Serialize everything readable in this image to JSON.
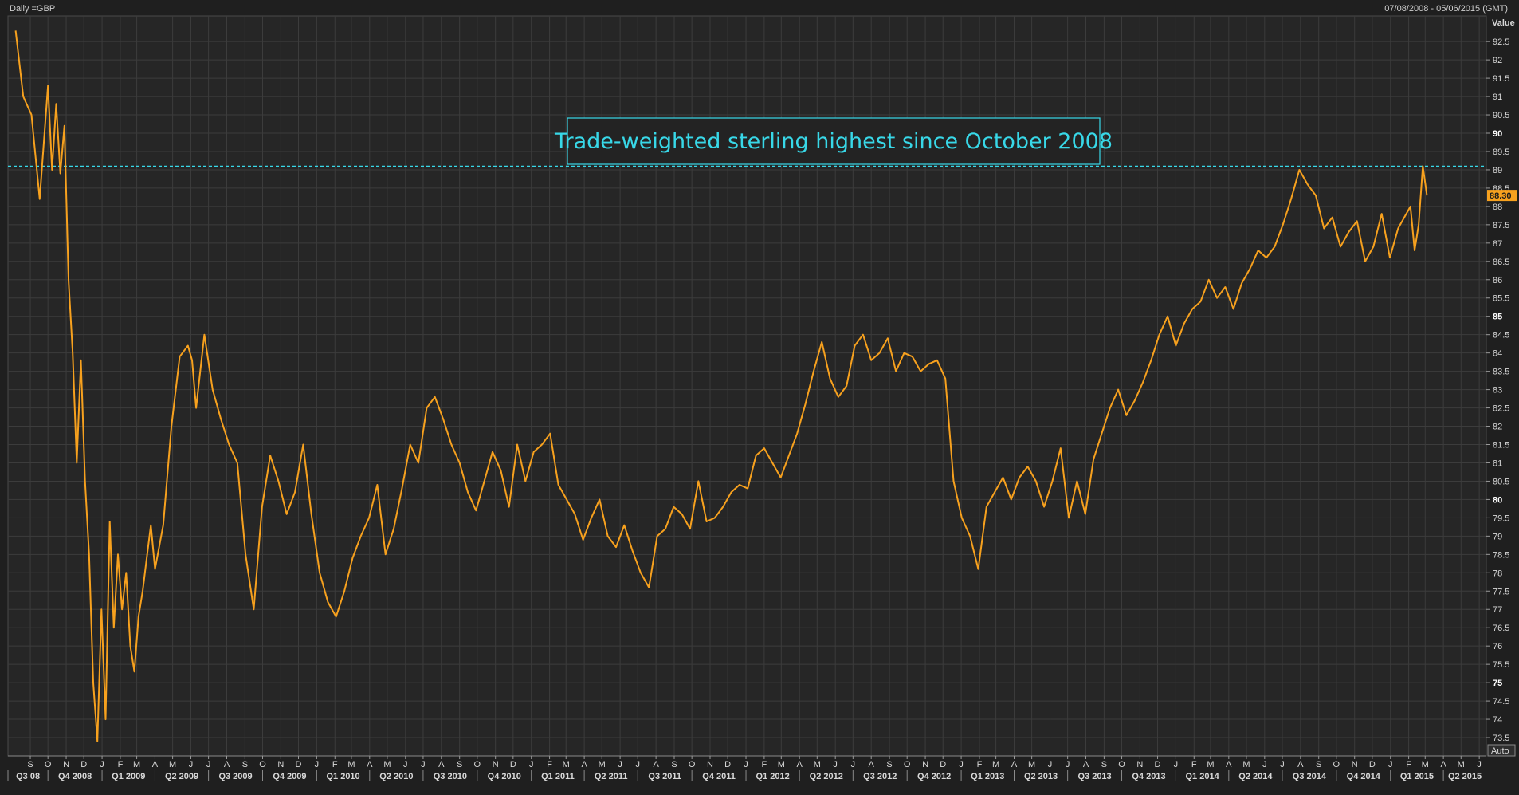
{
  "header": {
    "left_text": "Daily =GBP",
    "right_text": "07/08/2008 - 05/06/2015 (GMT)"
  },
  "colors": {
    "background": "#1f1f1f",
    "plot_background": "#262626",
    "grid": "#3c3c3c",
    "line": "#f7a11e",
    "annotation": "#38d8e8",
    "price_tag": "#f7a11e"
  },
  "chart_data": {
    "type": "line",
    "title": "",
    "xlabel": "",
    "ylabel": "Value",
    "ylim": [
      73,
      93
    ],
    "grid": true,
    "legend": "none",
    "series": [
      {
        "name": "",
        "x": [
          "2008-08-07",
          "2008-08-20",
          "2008-09-03",
          "2008-09-17",
          "2008-10-01",
          "2008-10-08",
          "2008-10-15",
          "2008-10-22",
          "2008-10-29",
          "2008-11-05",
          "2008-11-12",
          "2008-11-19",
          "2008-11-26",
          "2008-12-03",
          "2008-12-10",
          "2008-12-17",
          "2008-12-24",
          "2008-12-31",
          "2009-01-07",
          "2009-01-14",
          "2009-01-21",
          "2009-01-28",
          "2009-02-04",
          "2009-02-11",
          "2009-02-18",
          "2009-02-25",
          "2009-03-04",
          "2009-03-11",
          "2009-03-18",
          "2009-03-25",
          "2009-04-01",
          "2009-04-15",
          "2009-04-29",
          "2009-05-13",
          "2009-05-27",
          "2009-06-03",
          "2009-06-10",
          "2009-06-24",
          "2009-07-08",
          "2009-07-22",
          "2009-08-05",
          "2009-08-19",
          "2009-09-02",
          "2009-09-16",
          "2009-09-30",
          "2009-10-14",
          "2009-10-28",
          "2009-11-11",
          "2009-11-25",
          "2009-12-09",
          "2009-12-23",
          "2010-01-06",
          "2010-01-20",
          "2010-02-03",
          "2010-02-17",
          "2010-03-03",
          "2010-03-17",
          "2010-03-31",
          "2010-04-14",
          "2010-04-28",
          "2010-05-12",
          "2010-05-26",
          "2010-06-09",
          "2010-06-23",
          "2010-07-07",
          "2010-07-21",
          "2010-08-04",
          "2010-08-18",
          "2010-09-01",
          "2010-09-15",
          "2010-09-29",
          "2010-10-13",
          "2010-10-27",
          "2010-11-10",
          "2010-11-24",
          "2010-12-08",
          "2010-12-22",
          "2011-01-05",
          "2011-01-19",
          "2011-02-02",
          "2011-02-16",
          "2011-03-02",
          "2011-03-16",
          "2011-03-30",
          "2011-04-13",
          "2011-04-27",
          "2011-05-11",
          "2011-05-25",
          "2011-06-08",
          "2011-06-22",
          "2011-07-06",
          "2011-07-20",
          "2011-08-03",
          "2011-08-17",
          "2011-08-31",
          "2011-09-14",
          "2011-09-28",
          "2011-10-12",
          "2011-10-26",
          "2011-11-09",
          "2011-11-23",
          "2011-12-07",
          "2011-12-21",
          "2012-01-04",
          "2012-01-18",
          "2012-02-01",
          "2012-02-15",
          "2012-02-29",
          "2012-03-14",
          "2012-03-28",
          "2012-04-11",
          "2012-04-25",
          "2012-05-09",
          "2012-05-23",
          "2012-06-06",
          "2012-06-20",
          "2012-07-04",
          "2012-07-18",
          "2012-08-01",
          "2012-08-15",
          "2012-08-29",
          "2012-09-12",
          "2012-09-26",
          "2012-10-10",
          "2012-10-24",
          "2012-11-07",
          "2012-11-21",
          "2012-12-05",
          "2012-12-19",
          "2013-01-02",
          "2013-01-16",
          "2013-01-30",
          "2013-02-13",
          "2013-02-27",
          "2013-03-13",
          "2013-03-27",
          "2013-04-10",
          "2013-04-24",
          "2013-05-08",
          "2013-05-22",
          "2013-06-05",
          "2013-06-19",
          "2013-07-03",
          "2013-07-17",
          "2013-07-31",
          "2013-08-14",
          "2013-08-28",
          "2013-09-11",
          "2013-09-25",
          "2013-10-09",
          "2013-10-23",
          "2013-11-06",
          "2013-11-20",
          "2013-12-04",
          "2013-12-18",
          "2014-01-01",
          "2014-01-15",
          "2014-01-29",
          "2014-02-12",
          "2014-02-26",
          "2014-03-12",
          "2014-03-26",
          "2014-04-09",
          "2014-04-23",
          "2014-05-07",
          "2014-05-21",
          "2014-06-04",
          "2014-06-18",
          "2014-07-02",
          "2014-07-16",
          "2014-07-30",
          "2014-08-13",
          "2014-08-27",
          "2014-09-10",
          "2014-09-24",
          "2014-10-08",
          "2014-10-22",
          "2014-11-05",
          "2014-11-19",
          "2014-12-03",
          "2014-12-17",
          "2014-12-31",
          "2015-01-14",
          "2015-01-28",
          "2015-02-04",
          "2015-02-11",
          "2015-02-18",
          "2015-02-25",
          "2015-03-04"
        ],
        "values": [
          92.8,
          91.0,
          90.5,
          88.2,
          91.3,
          89.0,
          90.8,
          88.9,
          90.2,
          86.0,
          84.0,
          81.0,
          83.8,
          80.5,
          78.5,
          75.0,
          73.4,
          77.0,
          74.0,
          79.4,
          76.5,
          78.5,
          77.0,
          78.0,
          76.0,
          75.3,
          76.8,
          77.5,
          78.4,
          79.3,
          78.1,
          79.3,
          82.0,
          83.9,
          84.2,
          83.8,
          82.5,
          84.5,
          83.0,
          82.2,
          81.5,
          81.0,
          78.5,
          77.0,
          79.8,
          81.2,
          80.5,
          79.6,
          80.2,
          81.5,
          79.6,
          78.0,
          77.2,
          76.8,
          77.5,
          78.4,
          79.0,
          79.5,
          80.4,
          78.5,
          79.2,
          80.3,
          81.5,
          81.0,
          82.5,
          82.8,
          82.2,
          81.5,
          81.0,
          80.2,
          79.7,
          80.5,
          81.3,
          80.8,
          79.8,
          81.5,
          80.5,
          81.3,
          81.5,
          81.8,
          80.4,
          80.0,
          79.6,
          78.9,
          79.5,
          80.0,
          79.0,
          78.7,
          79.3,
          78.6,
          78.0,
          77.6,
          79.0,
          79.2,
          79.8,
          79.6,
          79.2,
          80.5,
          79.4,
          79.5,
          79.8,
          80.2,
          80.4,
          80.3,
          81.2,
          81.4,
          81.0,
          80.6,
          81.2,
          81.8,
          82.6,
          83.5,
          84.3,
          83.3,
          82.8,
          83.1,
          84.2,
          84.5,
          83.8,
          84.0,
          84.4,
          83.5,
          84.0,
          83.9,
          83.5,
          83.7,
          83.8,
          83.3,
          80.5,
          79.5,
          79.0,
          78.1,
          79.8,
          80.2,
          80.6,
          80.0,
          80.6,
          80.9,
          80.5,
          79.8,
          80.5,
          81.4,
          79.5,
          80.5,
          79.6,
          81.1,
          81.8,
          82.5,
          83.0,
          82.3,
          82.7,
          83.2,
          83.8,
          84.5,
          85.0,
          84.2,
          84.8,
          85.2,
          85.4,
          86.0,
          85.5,
          85.8,
          85.2,
          85.9,
          86.3,
          86.8,
          86.6,
          86.9,
          87.5,
          88.2,
          89.0,
          88.6,
          88.3,
          87.4,
          87.7,
          86.9,
          87.3,
          87.6,
          86.5,
          86.9,
          87.8,
          86.6,
          87.4,
          87.8,
          88.0,
          86.8,
          87.5,
          89.1,
          88.3
        ]
      }
    ],
    "y_ticks": [
      "73.5",
      "74",
      "74.5",
      "75",
      "75.5",
      "76",
      "76.5",
      "77",
      "77.5",
      "78",
      "78.5",
      "79",
      "79.5",
      "80",
      "80.5",
      "81",
      "81.5",
      "82",
      "82.5",
      "83",
      "83.5",
      "84",
      "84.5",
      "85",
      "85.5",
      "86",
      "86.5",
      "87",
      "87.5",
      "88",
      "88.5",
      "89",
      "89.5",
      "90",
      "90.5",
      "91",
      "91.5",
      "92",
      "92.5"
    ],
    "y_ticks_bold": [
      "75",
      "80",
      "85",
      "90"
    ],
    "last_value": 88.3,
    "last_value_label": "88.30",
    "y_axis_header": "Value",
    "auto_label": "Auto",
    "x_month_ticks": [
      {
        "date": "2008-09-01",
        "label": "S"
      },
      {
        "date": "2008-10-01",
        "label": "O"
      },
      {
        "date": "2008-11-01",
        "label": "N"
      },
      {
        "date": "2008-12-01",
        "label": "D"
      },
      {
        "date": "2009-01-01",
        "label": "J"
      },
      {
        "date": "2009-02-01",
        "label": "F"
      },
      {
        "date": "2009-03-01",
        "label": "M"
      },
      {
        "date": "2009-04-01",
        "label": "A"
      },
      {
        "date": "2009-05-01",
        "label": "M"
      },
      {
        "date": "2009-06-01",
        "label": "J"
      },
      {
        "date": "2009-07-01",
        "label": "J"
      },
      {
        "date": "2009-08-01",
        "label": "A"
      },
      {
        "date": "2009-09-01",
        "label": "S"
      },
      {
        "date": "2009-10-01",
        "label": "O"
      },
      {
        "date": "2009-11-01",
        "label": "N"
      },
      {
        "date": "2009-12-01",
        "label": "D"
      },
      {
        "date": "2010-01-01",
        "label": "J"
      },
      {
        "date": "2010-02-01",
        "label": "F"
      },
      {
        "date": "2010-03-01",
        "label": "M"
      },
      {
        "date": "2010-04-01",
        "label": "A"
      },
      {
        "date": "2010-05-01",
        "label": "M"
      },
      {
        "date": "2010-06-01",
        "label": "J"
      },
      {
        "date": "2010-07-01",
        "label": "J"
      },
      {
        "date": "2010-08-01",
        "label": "A"
      },
      {
        "date": "2010-09-01",
        "label": "S"
      },
      {
        "date": "2010-10-01",
        "label": "O"
      },
      {
        "date": "2010-11-01",
        "label": "N"
      },
      {
        "date": "2010-12-01",
        "label": "D"
      },
      {
        "date": "2011-01-01",
        "label": "J"
      },
      {
        "date": "2011-02-01",
        "label": "F"
      },
      {
        "date": "2011-03-01",
        "label": "M"
      },
      {
        "date": "2011-04-01",
        "label": "A"
      },
      {
        "date": "2011-05-01",
        "label": "M"
      },
      {
        "date": "2011-06-01",
        "label": "J"
      },
      {
        "date": "2011-07-01",
        "label": "J"
      },
      {
        "date": "2011-08-01",
        "label": "A"
      },
      {
        "date": "2011-09-01",
        "label": "S"
      },
      {
        "date": "2011-10-01",
        "label": "O"
      },
      {
        "date": "2011-11-01",
        "label": "N"
      },
      {
        "date": "2011-12-01",
        "label": "D"
      },
      {
        "date": "2012-01-01",
        "label": "J"
      },
      {
        "date": "2012-02-01",
        "label": "F"
      },
      {
        "date": "2012-03-01",
        "label": "M"
      },
      {
        "date": "2012-04-01",
        "label": "A"
      },
      {
        "date": "2012-05-01",
        "label": "M"
      },
      {
        "date": "2012-06-01",
        "label": "J"
      },
      {
        "date": "2012-07-01",
        "label": "J"
      },
      {
        "date": "2012-08-01",
        "label": "A"
      },
      {
        "date": "2012-09-01",
        "label": "S"
      },
      {
        "date": "2012-10-01",
        "label": "O"
      },
      {
        "date": "2012-11-01",
        "label": "N"
      },
      {
        "date": "2012-12-01",
        "label": "D"
      },
      {
        "date": "2013-01-01",
        "label": "J"
      },
      {
        "date": "2013-02-01",
        "label": "F"
      },
      {
        "date": "2013-03-01",
        "label": "M"
      },
      {
        "date": "2013-04-01",
        "label": "A"
      },
      {
        "date": "2013-05-01",
        "label": "M"
      },
      {
        "date": "2013-06-01",
        "label": "J"
      },
      {
        "date": "2013-07-01",
        "label": "J"
      },
      {
        "date": "2013-08-01",
        "label": "A"
      },
      {
        "date": "2013-09-01",
        "label": "S"
      },
      {
        "date": "2013-10-01",
        "label": "O"
      },
      {
        "date": "2013-11-01",
        "label": "N"
      },
      {
        "date": "2013-12-01",
        "label": "D"
      },
      {
        "date": "2014-01-01",
        "label": "J"
      },
      {
        "date": "2014-02-01",
        "label": "F"
      },
      {
        "date": "2014-03-01",
        "label": "M"
      },
      {
        "date": "2014-04-01",
        "label": "A"
      },
      {
        "date": "2014-05-01",
        "label": "M"
      },
      {
        "date": "2014-06-01",
        "label": "J"
      },
      {
        "date": "2014-07-01",
        "label": "J"
      },
      {
        "date": "2014-08-01",
        "label": "A"
      },
      {
        "date": "2014-09-01",
        "label": "S"
      },
      {
        "date": "2014-10-01",
        "label": "O"
      },
      {
        "date": "2014-11-01",
        "label": "N"
      },
      {
        "date": "2014-12-01",
        "label": "D"
      },
      {
        "date": "2015-01-01",
        "label": "J"
      },
      {
        "date": "2015-02-01",
        "label": "F"
      },
      {
        "date": "2015-03-01",
        "label": "M"
      },
      {
        "date": "2015-04-01",
        "label": "A"
      },
      {
        "date": "2015-05-01",
        "label": "M"
      },
      {
        "date": "2015-06-01",
        "label": "J"
      }
    ],
    "x_quarter_ticks": [
      {
        "date": "2008-07-01",
        "label": "Q3 08"
      },
      {
        "date": "2008-10-01",
        "label": "Q4 2008"
      },
      {
        "date": "2009-01-01",
        "label": "Q1 2009"
      },
      {
        "date": "2009-04-01",
        "label": "Q2 2009"
      },
      {
        "date": "2009-07-01",
        "label": "Q3 2009"
      },
      {
        "date": "2009-10-01",
        "label": "Q4 2009"
      },
      {
        "date": "2010-01-01",
        "label": "Q1 2010"
      },
      {
        "date": "2010-04-01",
        "label": "Q2 2010"
      },
      {
        "date": "2010-07-01",
        "label": "Q3 2010"
      },
      {
        "date": "2010-10-01",
        "label": "Q4 2010"
      },
      {
        "date": "2011-01-01",
        "label": "Q1 2011"
      },
      {
        "date": "2011-04-01",
        "label": "Q2 2011"
      },
      {
        "date": "2011-07-01",
        "label": "Q3 2011"
      },
      {
        "date": "2011-10-01",
        "label": "Q4 2011"
      },
      {
        "date": "2012-01-01",
        "label": "Q1 2012"
      },
      {
        "date": "2012-04-01",
        "label": "Q2 2012"
      },
      {
        "date": "2012-07-01",
        "label": "Q3 2012"
      },
      {
        "date": "2012-10-01",
        "label": "Q4 2012"
      },
      {
        "date": "2013-01-01",
        "label": "Q1 2013"
      },
      {
        "date": "2013-04-01",
        "label": "Q2 2013"
      },
      {
        "date": "2013-07-01",
        "label": "Q3 2013"
      },
      {
        "date": "2013-10-01",
        "label": "Q4 2013"
      },
      {
        "date": "2014-01-01",
        "label": "Q1 2014"
      },
      {
        "date": "2014-04-01",
        "label": "Q2 2014"
      },
      {
        "date": "2014-07-01",
        "label": "Q3 2014"
      },
      {
        "date": "2014-10-01",
        "label": "Q4 2014"
      },
      {
        "date": "2015-01-01",
        "label": "Q1 2015"
      },
      {
        "date": "2015-04-01",
        "label": "Q2 2015"
      }
    ],
    "annotation": {
      "text": "Trade-weighted sterling highest since October 2008",
      "reference_value": 89.1
    }
  }
}
